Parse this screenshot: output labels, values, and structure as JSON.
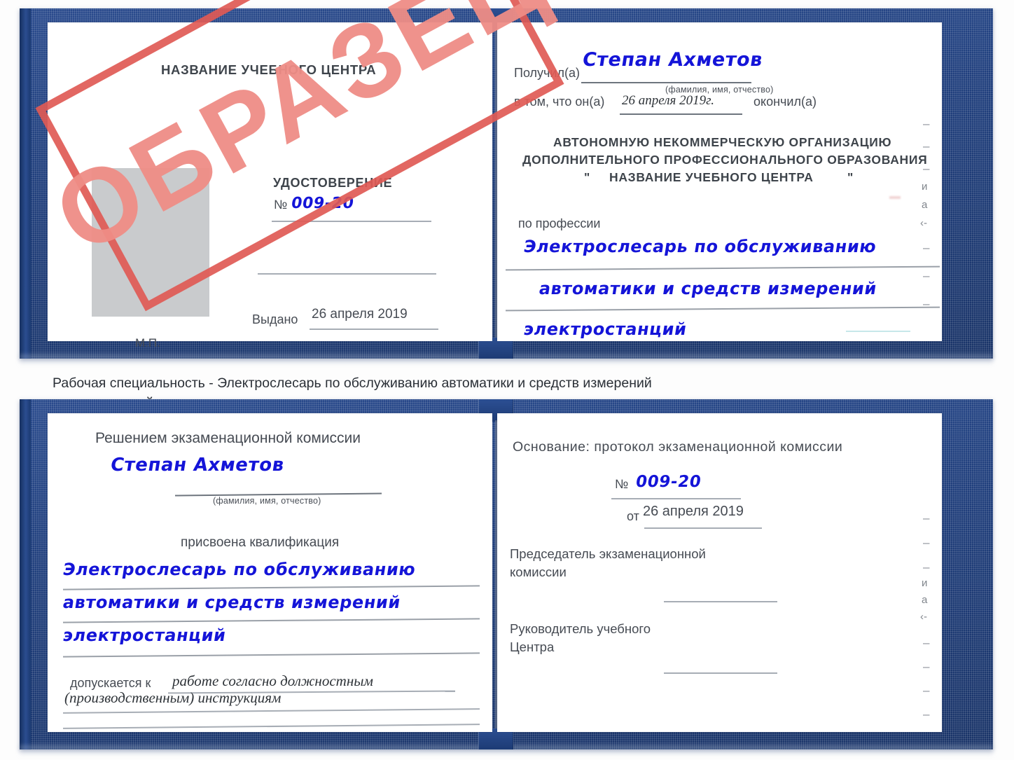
{
  "document": {
    "type": "certificate-scan",
    "watermark": {
      "label": "ОБРАЗЕЦ",
      "color": "#ef8d86",
      "frame_color": "#e05a55"
    },
    "cover_color": "#21407e"
  },
  "certificate_top": {
    "left_page": {
      "center_name": "НАЗВАНИЕ УЧЕБНОГО ЦЕНТРА",
      "title": "УДОСТОВЕРЕНИЕ",
      "number_label": "№",
      "number_value": "009-20",
      "issued_label": "Выдано",
      "issued_value": "26 апреля 2019",
      "seal_label": "М.П."
    },
    "right_page": {
      "received_label": "Получил(а)",
      "received_value": "Степан Ахметов",
      "name_hint": "(фамилия, имя, отчество)",
      "that_he_label": "в том, что он(а)",
      "graduation_date": "26 апреля 2019г.",
      "finished_label": "окончил(а)",
      "org_line1": "АВТОНОМНУЮ НЕКОММЕРЧЕСКУЮ ОРГАНИЗАЦИЮ",
      "org_line2": "ДОПОЛНИТЕЛЬНОГО ПРОФЕССИОНАЛЬНОГО ОБРАЗОВАНИЯ",
      "org_quote_open": "\"",
      "org_line3": "НАЗВАНИЕ УЧЕБНОГО ЦЕНТРА",
      "org_quote_close": "\"",
      "profession_label": "по профессии",
      "profession_line1": "Электрослесарь по обслуживанию",
      "profession_line2": "автоматики и средств измерений",
      "profession_line3": "электростанций",
      "margin_marks": [
        "–",
        "–",
        "–",
        "и",
        "а",
        "‹-",
        "–",
        "–",
        "–"
      ]
    }
  },
  "caption": {
    "line1": "Рабочая специальность - Электрослесарь по обслуживанию автоматики и средств измерений",
    "line2": "электростанций"
  },
  "certificate_bottom": {
    "left_page": {
      "heading": "Решением экзаменационной комиссии",
      "name_value": "Степан Ахметов",
      "name_hint": "(фамилия, имя, отчество)",
      "qualification_label": "присвоена квалификация",
      "qualification_line1": "Электрослесарь по обслуживанию",
      "qualification_line2": "автоматики и средств измерений",
      "qualification_line3": "электростанций",
      "admitted_label": "допускается к",
      "admitted_value_line1": "работе согласно должностным",
      "admitted_value_line2": "(производственным) инструкциям"
    },
    "right_page": {
      "basis_label": "Основание: протокол экзаменационной комиссии",
      "number_label": "№",
      "number_value": "009-20",
      "date_label": "от",
      "date_value": "26 апреля 2019",
      "chair_line1": "Председатель экзаменационной",
      "chair_line2": "комиссии",
      "head_line1": "Руководитель учебного",
      "head_line2": "Центра",
      "margin_marks": [
        "–",
        "–",
        "–",
        "и",
        "а",
        "‹-",
        "–",
        "–",
        "–",
        "–"
      ]
    }
  }
}
